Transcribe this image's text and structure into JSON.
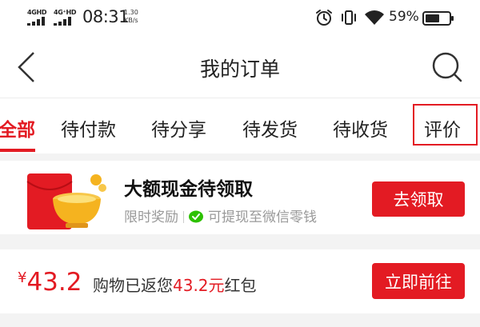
{
  "status_bar": {
    "sim1_label": "4GHD",
    "sim2_label": "4G⁺HD",
    "time": "08:31",
    "net_speed_value": "1.30",
    "net_speed_unit": "KB/s",
    "battery_percent": "59%"
  },
  "header": {
    "title": "我的订单"
  },
  "tabs": [
    {
      "label": "全部",
      "active": true
    },
    {
      "label": "待付款"
    },
    {
      "label": "待分享"
    },
    {
      "label": "待发货"
    },
    {
      "label": "待收货"
    },
    {
      "label": "评价"
    }
  ],
  "cash_card": {
    "title": "大额现金待领取",
    "sub_left": "限时奖励",
    "sub_right": "可提现至微信零钱",
    "button_label": "去领取"
  },
  "rebate_card": {
    "currency": "¥",
    "amount": "43.2",
    "text_prefix": "购物已返您",
    "text_amount": "43.2元",
    "text_suffix": "红包",
    "button_label": "立即前往"
  },
  "colors": {
    "accent": "#e31b23",
    "wechat_green": "#2dc100",
    "gold": "#f5b31f"
  }
}
